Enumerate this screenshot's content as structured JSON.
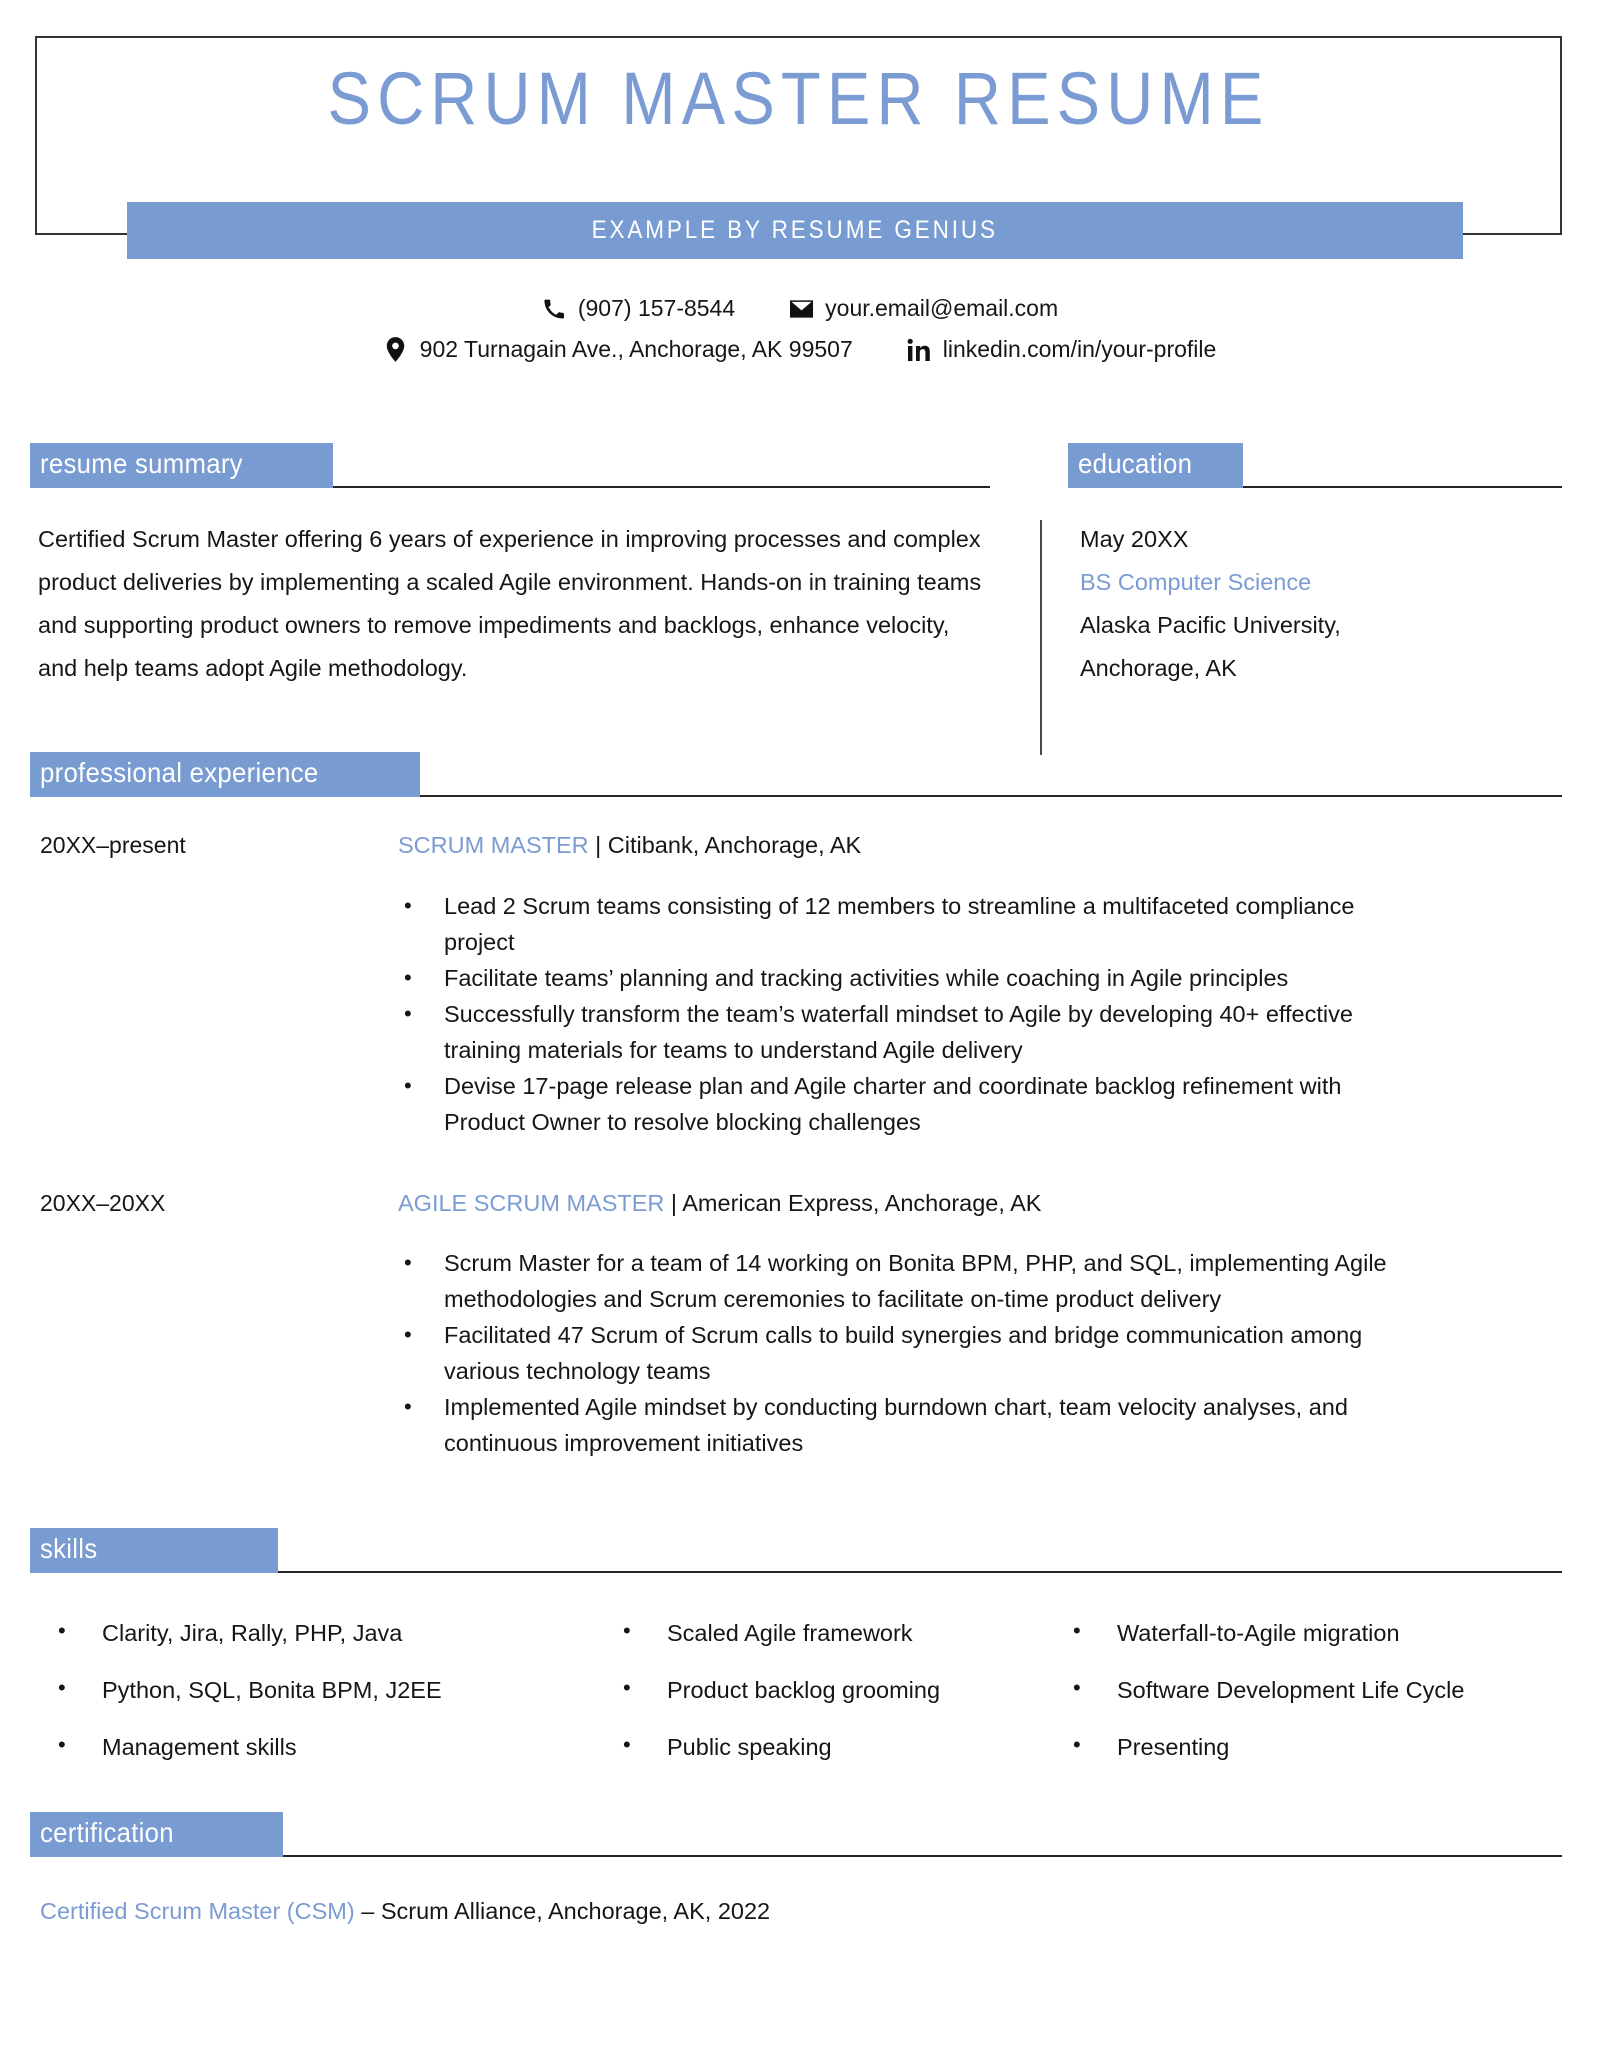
{
  "header": {
    "title": "SCRUM MASTER RESUME",
    "subtitle": "EXAMPLE BY RESUME GENIUS"
  },
  "colors": {
    "accent_blue": "#789bd2",
    "title_blue": "#7b9bd3",
    "text": "#161616",
    "rule": "#262626"
  },
  "contact": {
    "phone": "(907) 157-8544",
    "email": "your.email@email.com",
    "address": "902 Turnagain Ave., Anchorage, AK 99507",
    "linkedin": "linkedin.com/in/your-profile",
    "icons": {
      "phone": "phone-icon",
      "email": "envelope-icon",
      "address": "map-pin-icon",
      "linkedin": "linkedin-icon"
    }
  },
  "sections": {
    "summary_heading": "resume summary",
    "education_heading": "education",
    "experience_heading": "professional experience",
    "skills_heading": "skills",
    "certification_heading": "certification"
  },
  "summary": {
    "text": "Certified Scrum Master offering 6 years of experience in improving processes and complex product deliveries by implementing a scaled Agile environment. Hands-on in training teams and supporting product owners to remove impediments and backlogs, enhance velocity, and help teams adopt Agile methodology."
  },
  "education": {
    "date": "May 20XX",
    "degree": "BS Computer Science",
    "school_line1": "Alaska Pacific University,",
    "school_line2": "Anchorage, AK"
  },
  "experience": [
    {
      "date": "20XX–present",
      "title": "SCRUM MASTER",
      "separator": " | ",
      "company": "Citibank, Anchorage, AK",
      "bullets": [
        "Lead 2 Scrum teams consisting of 12 members to streamline a multifaceted compliance project",
        "Facilitate teams’ planning and tracking activities while coaching in Agile principles",
        "Successfully transform the team’s waterfall mindset to Agile by developing 40+ effective training materials for teams to understand Agile delivery",
        "Devise 17-page release plan and Agile charter and coordinate backlog refinement with Product Owner to resolve blocking challenges"
      ]
    },
    {
      "date": "20XX–20XX",
      "title": "AGILE SCRUM MASTER",
      "separator": " | ",
      "company": "American Express, Anchorage, AK",
      "bullets": [
        "Scrum Master for a team of 14 working on Bonita BPM, PHP, and SQL, implementing Agile methodologies and Scrum ceremonies to facilitate on-time product delivery",
        "Facilitated 47 Scrum of Scrum calls to build synergies and bridge communication among various technology teams",
        "Implemented Agile mindset by conducting burndown chart, team velocity analyses, and continuous improvement initiatives"
      ]
    }
  ],
  "skills": [
    "Clarity, Jira, Rally, PHP, Java",
    "Scaled Agile framework",
    "Waterfall-to-Agile migration",
    "Python, SQL, Bonita BPM, J2EE",
    "Product backlog grooming",
    "Software Development Life Cycle",
    "Management skills",
    "Public speaking",
    "Presenting"
  ],
  "certification": {
    "name": "Certified Scrum Master (CSM)",
    "detail": " – Scrum Alliance, Anchorage, AK, 2022"
  }
}
